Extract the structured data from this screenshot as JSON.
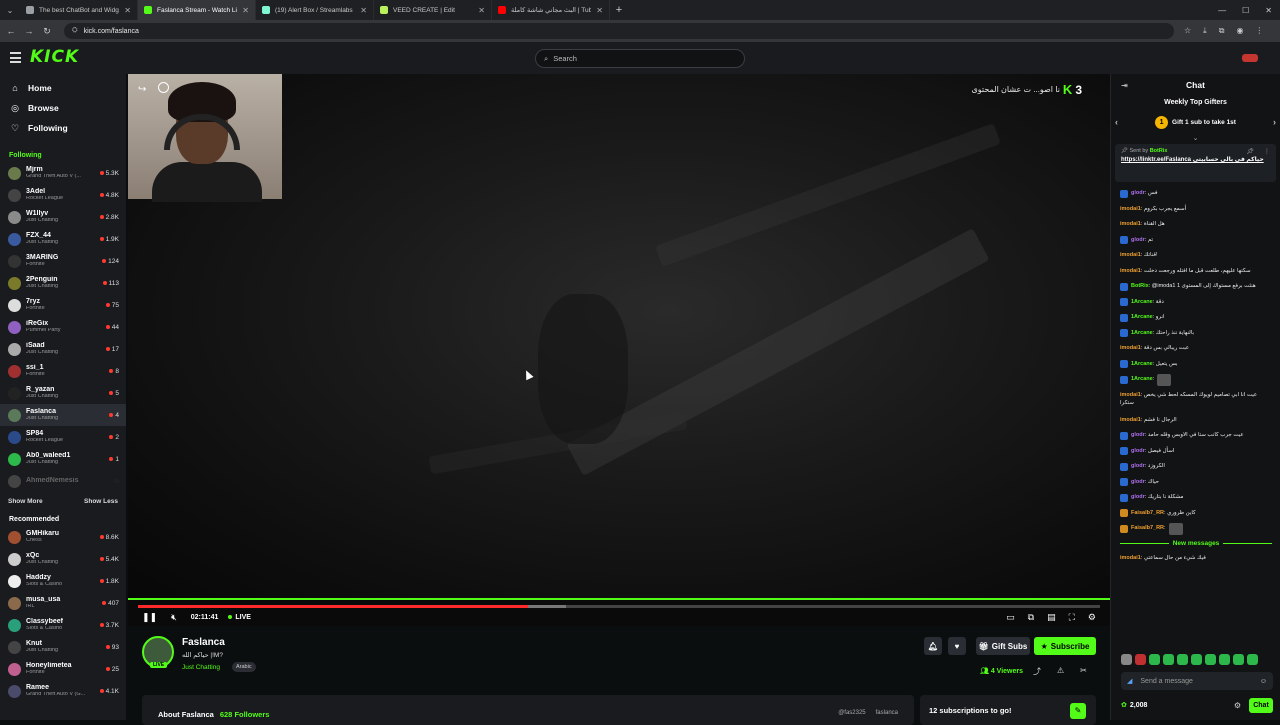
{
  "browser": {
    "tabs": [
      {
        "title": "The best ChatBot and Widgets",
        "color": "#9aa0a6"
      },
      {
        "title": "Faslanca Stream - Watch Live o",
        "color": "#53fc18"
      },
      {
        "title": "(19) Alert Box / Streamlabs",
        "color": "#80f5d2"
      },
      {
        "title": "VEED CREATE | Edit",
        "color": "#b8f15a"
      },
      {
        "title": "البث مجاني شاشة كاملة | Tube",
        "color": "#ff0000"
      }
    ],
    "url": "kick.com/faslanca"
  },
  "header": {
    "logo": "KICK",
    "search_placeholder": "Search"
  },
  "sidebar": {
    "nav": [
      {
        "label": "Home",
        "icon": "home-icon",
        "glyph": "⌂"
      },
      {
        "label": "Browse",
        "icon": "compass-icon",
        "glyph": "◎"
      },
      {
        "label": "Following",
        "icon": "heart-icon",
        "glyph": "♡"
      }
    ],
    "following_label": "Following",
    "following": [
      {
        "name": "Mjrm",
        "cat": "Grand Theft Auto V (...",
        "viewers": "5.3K",
        "color": "#6a7a4a"
      },
      {
        "name": "3Adel",
        "cat": "Rocket League",
        "viewers": "4.8K",
        "color": "#444"
      },
      {
        "name": "W1llyv",
        "cat": "Just Chatting",
        "viewers": "2.8K",
        "color": "#8a8a8a"
      },
      {
        "name": "FZX_44",
        "cat": "Just Chatting",
        "viewers": "1.9K",
        "color": "#3a5aa0"
      },
      {
        "name": "3MARING",
        "cat": "Fortnite",
        "viewers": "124",
        "color": "#333"
      },
      {
        "name": "2Penguin",
        "cat": "Just Chatting",
        "viewers": "113",
        "color": "#7a7a2a"
      },
      {
        "name": "7ryz",
        "cat": "Fortnite",
        "viewers": "75",
        "color": "#ddd"
      },
      {
        "name": "iReGix",
        "cat": "Pummel Party",
        "viewers": "44",
        "color": "#9060c0"
      },
      {
        "name": "iSaad",
        "cat": "Just Chatting",
        "viewers": "17",
        "color": "#aaa"
      },
      {
        "name": "ssi_1",
        "cat": "Fortnite",
        "viewers": "8",
        "color": "#a03030"
      },
      {
        "name": "R_yazan",
        "cat": "Just Chatting",
        "viewers": "5",
        "color": "#222"
      },
      {
        "name": "Faslanca",
        "cat": "Just Chatting",
        "viewers": "4",
        "color": "#5a7a5a"
      },
      {
        "name": "SP84",
        "cat": "Rocket League",
        "viewers": "2",
        "color": "#2a4a8a"
      },
      {
        "name": "Ab0_waleed1",
        "cat": "Just Chatting",
        "viewers": "1",
        "color": "#2db84b"
      }
    ],
    "offline": {
      "name": "AhmedNemesis",
      "color": "#555"
    },
    "show_more": "Show More",
    "show_less": "Show Less",
    "recommended_label": "Recommended",
    "recommended": [
      {
        "name": "GMHikaru",
        "cat": "Chess",
        "viewers": "8.6K",
        "color": "#a05030"
      },
      {
        "name": "xQc",
        "cat": "Just Chatting",
        "viewers": "5.4K",
        "color": "#ccc"
      },
      {
        "name": "Haddzy",
        "cat": "Slots & Casino",
        "viewers": "1.8K",
        "color": "#eee"
      },
      {
        "name": "musa_usa",
        "cat": "IRL",
        "viewers": "407",
        "color": "#8a6a4a"
      },
      {
        "name": "Classybeef",
        "cat": "Slots & Casino",
        "viewers": "3.7K",
        "color": "#2aa07a"
      },
      {
        "name": "Knut",
        "cat": "Just Chatting",
        "viewers": "93",
        "color": "#444"
      },
      {
        "name": "Honeylimetea",
        "cat": "Fortnite",
        "viewers": "25",
        "color": "#c06090"
      },
      {
        "name": "Ramee",
        "cat": "Grand Theft Auto V (G...",
        "viewers": "4.1K",
        "color": "#4a4a6a"
      }
    ]
  },
  "player": {
    "overlay_text": "نا اصو... ت عشان المحتوى",
    "overlay_number": "3",
    "overlay_logo": "K",
    "time": "02:11:41",
    "live": "LIVE",
    "progress": 0.405
  },
  "info": {
    "streamer": "Faslanca",
    "live_tag": "LIVE",
    "title": "حياكم الله |!M?",
    "category": "Just Chatting",
    "language": "Arabic",
    "gift_subs": "Gift Subs",
    "subscribe": "Subscribe",
    "viewers": "4 Viewers",
    "about": "About Faslanca",
    "followers": "628 Followers",
    "social1": "@fas2325",
    "social2": "faslanca",
    "sub_goal": "12 subscriptions to go!"
  },
  "chat": {
    "title": "Chat",
    "gifters_title": "Weekly Top Gifters",
    "gift_prompt": "Gift 1 sub to take 1st",
    "coin": "1",
    "pinned_by_label": "Sent by",
    "pinned_by": "BotRix",
    "pinned_text": "https://linktr.ee/Faslanca حياكم في بالي حسابيتي",
    "messages": [
      {
        "user": "glodr",
        "color": "#b070f0",
        "text": "فس",
        "badge": "#2a6ad0"
      },
      {
        "user": "imodai1",
        "color": "#f0a030",
        "text": "أسمع يجرب بكروم",
        "badge": ""
      },
      {
        "user": "imodai1",
        "color": "#f0a030",
        "text": "هل القناة",
        "badge": ""
      },
      {
        "user": "glodr",
        "color": "#b070f0",
        "text": "تم",
        "badge": "#2a6ad0"
      },
      {
        "user": "imodai1",
        "color": "#f0a030",
        "text": "قناتك!",
        "badge": ""
      },
      {
        "user": "imodai1",
        "color": "#f0a030",
        "text": "سكتها عليهم، طلعت قبل ما افتله ورجعت دخلت",
        "badge": ""
      },
      {
        "user": "BotRix",
        "color": "#53fc18",
        "text": "@imoda1 هنئت برفع مستواك إلى المستوى 1",
        "badge": "#2a6ad0"
      },
      {
        "user": "1Arcane",
        "color": "#53fc18",
        "text": "دقة",
        "badge": "#2a6ad0"
      },
      {
        "user": "1Arcane",
        "color": "#53fc18",
        "text": "انرو",
        "badge": "#2a6ad0"
      },
      {
        "user": "1Arcane",
        "color": "#53fc18",
        "text": "بالنهاية ننذ راحتك",
        "badge": "#2a6ad0"
      },
      {
        "user": "imodai1",
        "color": "#f0a030",
        "text": "عبت ريبالي بس دقة",
        "badge": ""
      },
      {
        "user": "1Arcane",
        "color": "#53fc18",
        "text": "بس يتعيل",
        "badge": "#2a6ad0"
      },
      {
        "user": "1Arcane",
        "color": "#53fc18",
        "text": "",
        "badge": "#2a6ad0",
        "emote": true
      },
      {
        "user": "imodai1",
        "color": "#f0a030",
        "text": "عيت انا ابي تصاميم لويوك المسكه لحط شي يخص ستكرا",
        "badge": "",
        "two": true
      },
      {
        "user": "imodai1",
        "color": "#f0a030",
        "text": "الرجال نا فشم",
        "badge": ""
      },
      {
        "user": "glodr",
        "color": "#b070f0",
        "text": "عيت جرب كانب ستا في الاوبس وقله حامد",
        "badge": "#2a6ad0"
      },
      {
        "user": "glodr",
        "color": "#b070f0",
        "text": "اسأل فيصل",
        "badge": "#2a6ad0"
      },
      {
        "user": "glodr",
        "color": "#b070f0",
        "text": "الكروزد",
        "badge": "#2a6ad0"
      },
      {
        "user": "glodr",
        "color": "#b070f0",
        "text": "حياك",
        "badge": "#2a6ad0"
      },
      {
        "user": "glodr",
        "color": "#b070f0",
        "text": "مشكلة نا بتاريك",
        "badge": "#2a6ad0"
      },
      {
        "user": "Faisalb7_RR",
        "color": "#f0a030",
        "text": "كاين ظروري",
        "badge": "#d08a20"
      },
      {
        "user": "Faisalb7_RR",
        "color": "#f0a030",
        "text": "",
        "badge": "#d08a20",
        "emote": true
      }
    ],
    "new_messages": "New messages",
    "after": [
      {
        "user": "imodai1",
        "color": "#f0a030",
        "text": "فيك شيء من حال سماعتي",
        "badge": ""
      }
    ],
    "input_placeholder": "Send a message",
    "points": "2,008",
    "chat_button": "Chat"
  }
}
